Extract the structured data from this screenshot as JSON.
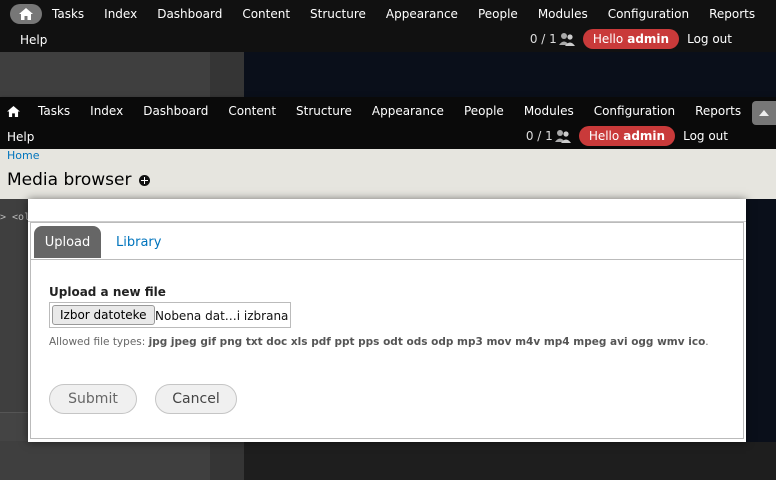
{
  "nav": {
    "items": [
      "Tasks",
      "Index",
      "Dashboard",
      "Content",
      "Structure",
      "Appearance",
      "People",
      "Modules",
      "Configuration",
      "Reports"
    ],
    "help": "Help",
    "counter": "0 / 1",
    "hello_prefix": "Hello",
    "hello_user": "admin",
    "logout": "Log out"
  },
  "breadcrumb": "Home",
  "page_title": "Media browser",
  "side_snippet": "> <ol>",
  "tabs": {
    "upload": "Upload",
    "library": "Library"
  },
  "form": {
    "label": "Upload a new file",
    "choose_button": "Izbor datoteke",
    "no_file": "Nobena dat…i izbrana",
    "allowed_prefix": "Allowed file types:",
    "allowed_types": "jpg jpeg gif png txt doc xls pdf ppt pps odt ods odp mp3 mov m4v mp4 mpeg avi ogg wmv ico",
    "submit": "Submit",
    "cancel": "Cancel"
  },
  "colors": {
    "accent_red": "#c93a3a",
    "link_blue": "#0074bd",
    "toolbar": "#0c0c0c"
  }
}
